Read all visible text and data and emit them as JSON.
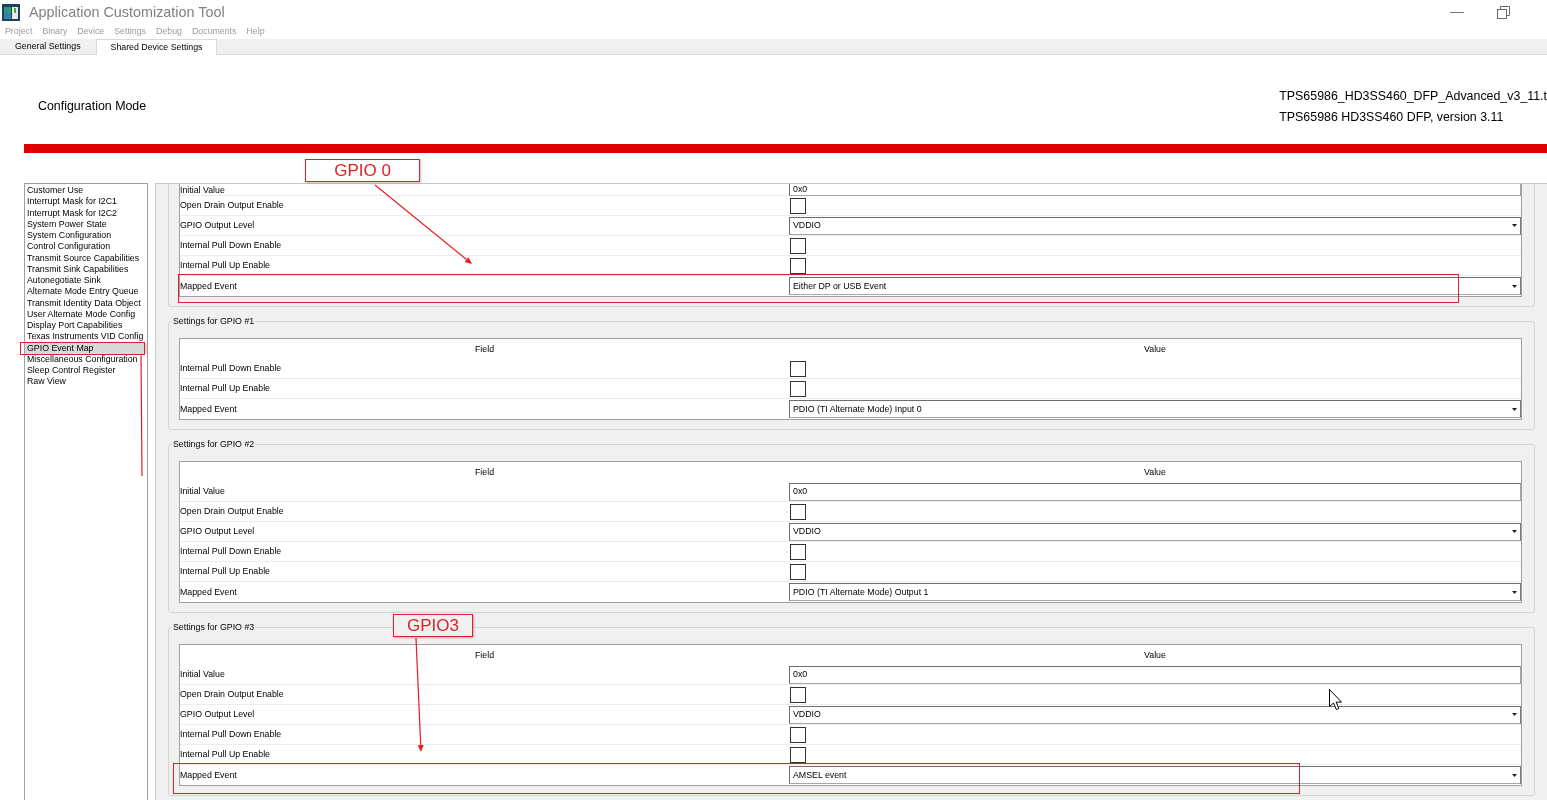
{
  "window": {
    "title": "Application Customization Tool"
  },
  "menu": [
    "Project",
    "Binary",
    "Device",
    "Settings",
    "Debug",
    "Documents",
    "Help"
  ],
  "tabs": [
    {
      "label": "General Settings",
      "selected": false
    },
    {
      "label": "Shared Device Settings",
      "selected": true
    }
  ],
  "header": {
    "mode": "Configuration Mode",
    "file_name": "TPS65986_HD3SS460_DFP_Advanced_v3_11.t",
    "version": "TPS65986 HD3SS460 DFP, version 3.11"
  },
  "sidebar": {
    "items": [
      {
        "label": "Customer Use",
        "selected": false,
        "highlighted": false
      },
      {
        "label": "Interrupt Mask for I2C1",
        "selected": false,
        "highlighted": false
      },
      {
        "label": "Interrupt Mask for I2C2",
        "selected": false,
        "highlighted": false
      },
      {
        "label": "System Power State",
        "selected": false,
        "highlighted": false
      },
      {
        "label": "System Configuration",
        "selected": false,
        "highlighted": false
      },
      {
        "label": "Control Configuration",
        "selected": false,
        "highlighted": false
      },
      {
        "label": "Transmit Source Capabilities",
        "selected": false,
        "highlighted": false
      },
      {
        "label": "Transmit Sink Capabilities",
        "selected": false,
        "highlighted": false
      },
      {
        "label": "Autonegotiate Sink",
        "selected": false,
        "highlighted": false
      },
      {
        "label": "Alternate Mode Entry Queue",
        "selected": false,
        "highlighted": false
      },
      {
        "label": "Transmit Identity Data Object",
        "selected": false,
        "highlighted": false
      },
      {
        "label": "User Alternate Mode Config",
        "selected": false,
        "highlighted": false
      },
      {
        "label": "Display Port Capabilities",
        "selected": false,
        "highlighted": false
      },
      {
        "label": "Texas Instruments VID Config",
        "selected": false,
        "highlighted": false
      },
      {
        "label": "GPIO Event Map",
        "selected": true,
        "highlighted": true
      },
      {
        "label": "Miscellaneous Configuration",
        "selected": false,
        "highlighted": false
      },
      {
        "label": "Sleep Control Register",
        "selected": false,
        "highlighted": false
      },
      {
        "label": "Raw View",
        "selected": false,
        "highlighted": false
      }
    ]
  },
  "groups": [
    {
      "callout": "GPIO 0",
      "rows": [
        {
          "field": "Initial Value",
          "kind": "text",
          "value": "0x0",
          "highlighted": false
        },
        {
          "field": "Open Drain Output Enable",
          "kind": "checkbox",
          "checked": false,
          "highlighted": false
        },
        {
          "field": "GPIO Output Level",
          "kind": "select",
          "value": "VDDIO",
          "highlighted": false
        },
        {
          "field": "Internal Pull Down Enable",
          "kind": "checkbox",
          "checked": false,
          "highlighted": false
        },
        {
          "field": "Internal Pull Up Enable",
          "kind": "checkbox",
          "checked": false,
          "highlighted": false
        },
        {
          "field": "Mapped Event",
          "kind": "select",
          "value": "Either DP or USB Event",
          "highlighted": true
        }
      ]
    },
    {
      "title": "Settings for GPIO #1",
      "columns": [
        "Field",
        "Value"
      ],
      "rows": [
        {
          "field": "Internal Pull Down Enable",
          "kind": "checkbox",
          "checked": false,
          "highlighted": false
        },
        {
          "field": "Internal Pull Up Enable",
          "kind": "checkbox",
          "checked": false,
          "highlighted": false
        },
        {
          "field": "Mapped Event",
          "kind": "select",
          "value": "PDIO (TI Alternate Mode) Input 0",
          "highlighted": false
        }
      ]
    },
    {
      "title": "Settings for GPIO #2",
      "columns": [
        "Field",
        "Value"
      ],
      "rows": [
        {
          "field": "Initial Value",
          "kind": "text",
          "value": "0x0",
          "highlighted": false
        },
        {
          "field": "Open Drain Output Enable",
          "kind": "checkbox",
          "checked": false,
          "highlighted": false
        },
        {
          "field": "GPIO Output Level",
          "kind": "select",
          "value": "VDDIO",
          "highlighted": false
        },
        {
          "field": "Internal Pull Down Enable",
          "kind": "checkbox",
          "checked": false,
          "highlighted": false
        },
        {
          "field": "Internal Pull Up Enable",
          "kind": "checkbox",
          "checked": false,
          "highlighted": false
        },
        {
          "field": "Mapped Event",
          "kind": "select",
          "value": "PDIO (TI Alternate Mode) Output 1",
          "highlighted": false
        }
      ]
    },
    {
      "title": "Settings for GPIO #3",
      "columns": [
        "Field",
        "Value"
      ],
      "callout": "GPIO3",
      "rows": [
        {
          "field": "Initial Value",
          "kind": "text",
          "value": "0x0",
          "highlighted": false
        },
        {
          "field": "Open Drain Output Enable",
          "kind": "checkbox",
          "checked": false,
          "highlighted": false
        },
        {
          "field": "GPIO Output Level",
          "kind": "select",
          "value": "VDDIO",
          "highlighted": false
        },
        {
          "field": "Internal Pull Down Enable",
          "kind": "checkbox",
          "checked": false,
          "highlighted": false
        },
        {
          "field": "Internal Pull Up Enable",
          "kind": "checkbox",
          "checked": false,
          "highlighted": false
        },
        {
          "field": "Mapped Event",
          "kind": "select",
          "value": "AMSEL event",
          "highlighted": true
        }
      ]
    }
  ]
}
